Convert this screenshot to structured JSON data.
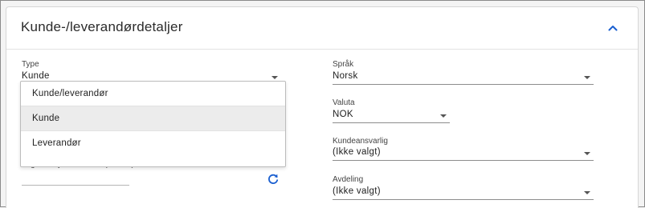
{
  "section": {
    "title": "Kunde-/leverandørdetaljer",
    "collapse_icon": "chevron-up-icon",
    "accent_color": "#1a5fd0"
  },
  "left": {
    "type": {
      "label": "Type",
      "value": "Kunde",
      "options": [
        "Kunde/leverandør",
        "Kunde",
        "Leverandør"
      ],
      "selected_option": "Kunde"
    },
    "org_number": {
      "label": "Organisasjonsnummer (9 siffer)",
      "value": "",
      "refresh_icon": "refresh-icon"
    }
  },
  "right": {
    "language": {
      "label": "Språk",
      "value": "Norsk"
    },
    "currency": {
      "label": "Valuta",
      "value": "NOK"
    },
    "account_manager": {
      "label": "Kundeansvarlig",
      "value": "(Ikke valgt)"
    },
    "department": {
      "label": "Avdeling",
      "value": "(Ikke valgt)"
    }
  }
}
